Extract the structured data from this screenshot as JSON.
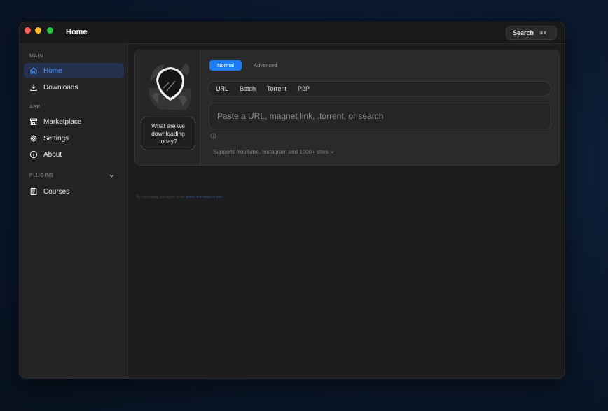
{
  "window": {
    "title": "Home"
  },
  "header": {
    "search_label": "Search",
    "search_shortcut": "⌘K"
  },
  "sidebar": {
    "sections": {
      "main": "MAIN",
      "app": "APP",
      "plugins": "PLUGINS"
    },
    "items": [
      {
        "label": "Home",
        "icon": "home-icon",
        "active": true
      },
      {
        "label": "Downloads",
        "icon": "download-icon"
      },
      {
        "label": "Marketplace",
        "icon": "store-icon"
      },
      {
        "label": "Settings",
        "icon": "gear-icon"
      },
      {
        "label": "About",
        "icon": "info-icon"
      },
      {
        "label": "Courses",
        "icon": "book-icon"
      }
    ]
  },
  "downloader": {
    "prompt": "What are we downloading today?",
    "modes": [
      "Normal",
      "Advanced"
    ],
    "active_mode": "Normal",
    "source_tabs": [
      "URL",
      "Batch",
      "Torrent",
      "P2P"
    ],
    "active_source": "URL",
    "input": {
      "value": "",
      "placeholder": "Paste a URL, magnet link, .torrent, or search"
    },
    "supports_text": "Supports YouTube, Instagram and 1000+ sites"
  },
  "footer": {
    "terms_prefix": "By continuing, you agree to the",
    "terms_link": "terms and ethics of use"
  },
  "colors": {
    "accent": "#1a7cf0",
    "active_nav_bg": "#243250",
    "active_nav_text": "#4a9cff",
    "window_bg": "#1c1c1e",
    "sidebar_bg": "#232325"
  }
}
